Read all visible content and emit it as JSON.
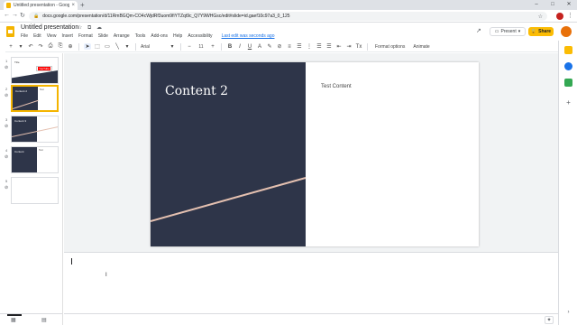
{
  "browser": {
    "tab_title": "Untitled presentation - Google Sl",
    "tab_close": "×",
    "new_tab": "+",
    "min": "–",
    "max": "□",
    "close": "✕",
    "back": "←",
    "forward": "→",
    "reload": "↻",
    "lock": "🔒",
    "url": "docs.google.com/presentation/d/11RmBGQm-CO4cWjdRf3uom9fiYTZqt9c_Q7Y9WHGsc/edit#slide=id.gaef10c97a3_0_125",
    "star": "☆",
    "menu": "⋮"
  },
  "docs": {
    "title": "Untitled presentation",
    "title_icons": "☆ ⧉ ☁",
    "menus": [
      "File",
      "Edit",
      "View",
      "Insert",
      "Format",
      "Slide",
      "Arrange",
      "Tools",
      "Add-ons",
      "Help",
      "Accessibility"
    ],
    "last_edit": "Last edit was seconds ago",
    "trend": "↗",
    "comment": "▤",
    "present_label": "Present",
    "present_caret": "▾",
    "share_label": "Share",
    "share_lock": "🔒"
  },
  "toolbar": {
    "icons_left": [
      "+",
      "▾",
      "↶",
      "↷",
      "⎙",
      "⎘",
      "⊕"
    ],
    "cursor": "➤",
    "tools": [
      "⬚",
      "▭",
      "╲",
      "▾"
    ],
    "font": "Arial",
    "font_caret": "▾",
    "minus": "−",
    "size": "11",
    "plus": "+",
    "format_icons": [
      "B",
      "I",
      "U",
      "A",
      "✎",
      "⊘",
      "≡",
      "☰",
      "⋮",
      "☰",
      "☰",
      "⇤",
      "⇥",
      "Tx"
    ],
    "format_options": "Format options",
    "animate": "Animate",
    "collapse": "⌃"
  },
  "filmstrip": {
    "slides": [
      {
        "num": "1",
        "title": "Title",
        "yt_text": "YouTube",
        "link": "⊘"
      },
      {
        "num": "2",
        "title": "Content 2",
        "label": "Test",
        "link": "⊘"
      },
      {
        "num": "3",
        "title": "Content 3",
        "label": "",
        "link": "⊘"
      },
      {
        "num": "4",
        "title": "Content",
        "label": "Test",
        "link": "⊘"
      },
      {
        "num": "5",
        "title": "",
        "label": "",
        "link": "⊘"
      }
    ]
  },
  "slide": {
    "title": "Content 2",
    "content": "Test Content",
    "panel_color": "#2e3549",
    "line_color": "#e4c0b0"
  },
  "notes": {
    "grip": "⋯",
    "ibeam": "I"
  },
  "bottombar": {
    "grid_view": "▦",
    "list_view": "▤",
    "explore": "✦"
  },
  "sidepanel": {
    "plus": "+",
    "collapse": "›"
  }
}
